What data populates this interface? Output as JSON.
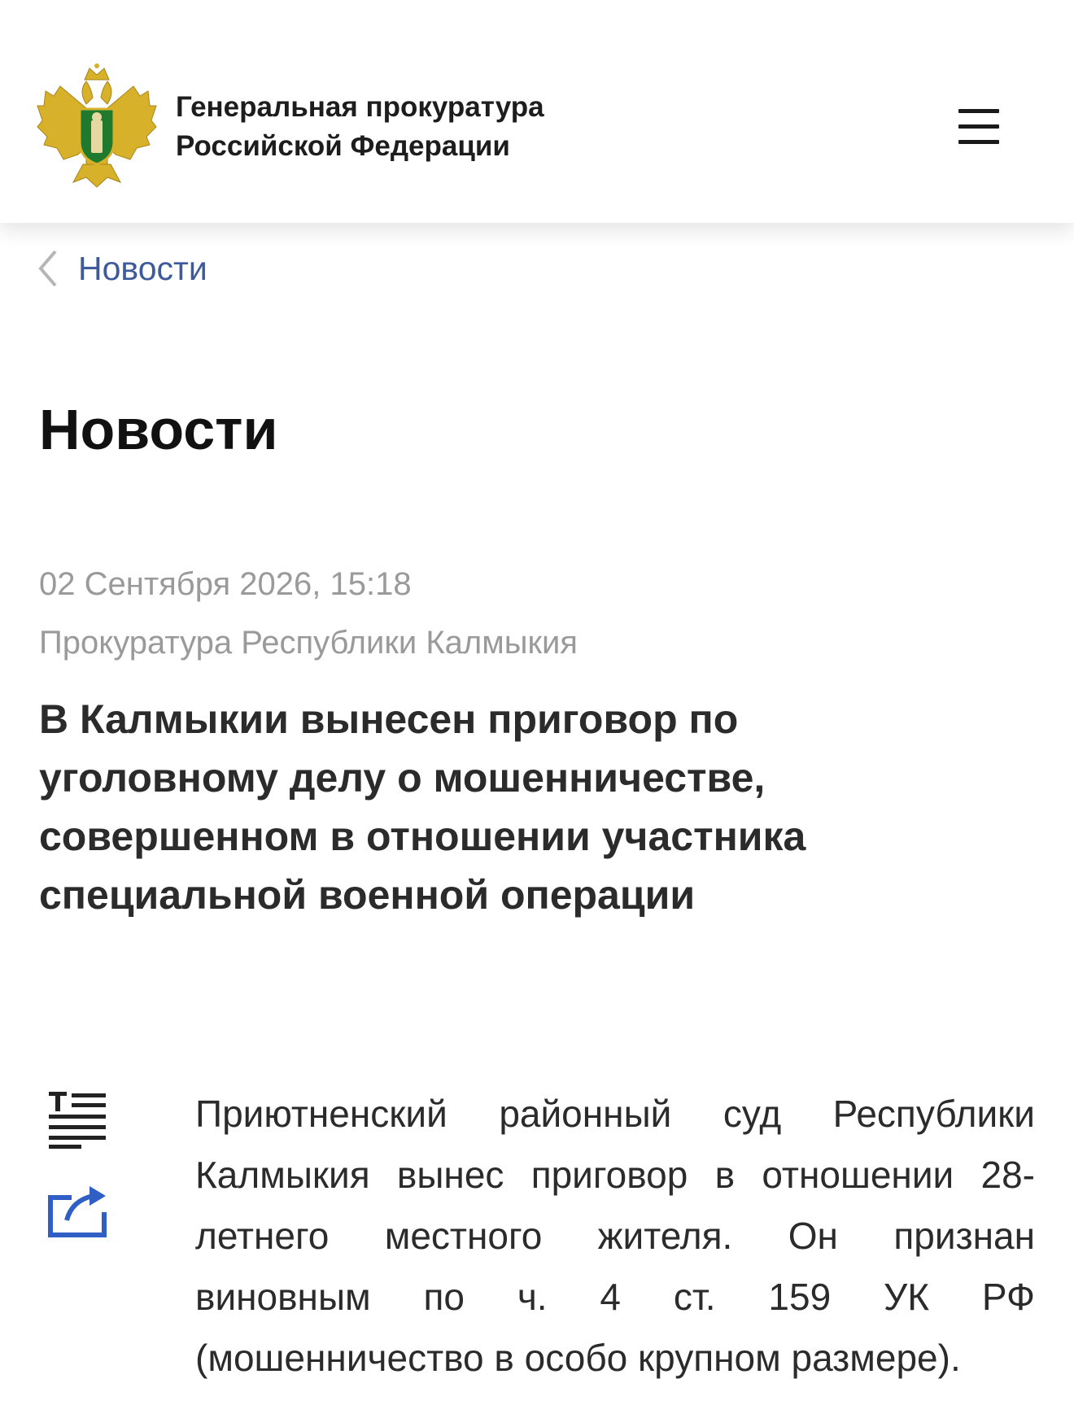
{
  "header": {
    "org_line1": "Генеральная прокуратура",
    "org_line2": "Российской Федерации",
    "logo_icon": "prosecutor-emblem-icon",
    "menu_icon": "hamburger-menu-icon"
  },
  "breadcrumb": {
    "label": "Новости",
    "icon": "chevron-left-icon"
  },
  "page": {
    "title": "Новости"
  },
  "article": {
    "date": "02 Сентября 2026, 15:18",
    "source": "Прокуратура Республики Калмыкия",
    "headline": "В Калмыкии вынесен приговор по уголовному делу о мошенничестве, совершенном в отношении участника специальной военной операции",
    "body": "Приютненский районный суд Республики Калмыкия вынес приговор в отношении 28-летнего местного жителя. Он признан виновным по ч. 4 ст. 159 УК РФ (мошенничество в особо крупном размере)."
  },
  "tools": {
    "text_size_icon": "text-size-icon",
    "share_icon": "share-icon"
  },
  "colors": {
    "link": "#3d5a9a",
    "meta": "#9a9a9a",
    "tool_blue": "#2f5fc4",
    "emblem_gold": "#d8b12a",
    "emblem_green": "#1f7a2e"
  }
}
